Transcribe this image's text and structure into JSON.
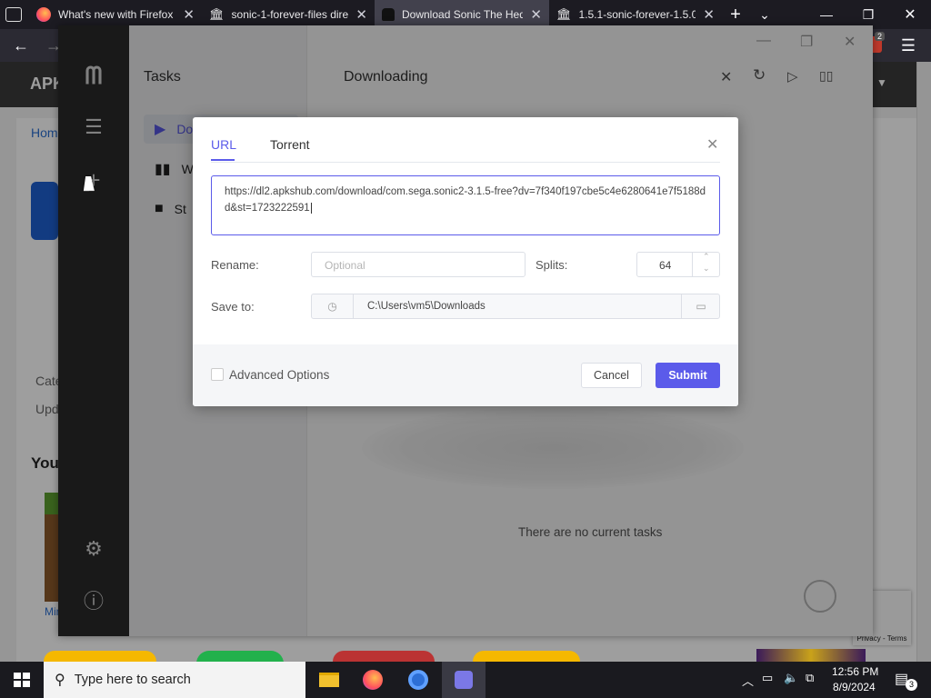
{
  "browser": {
    "tabs": [
      {
        "title": "What's new with Firefox",
        "icon": "firefox-icon",
        "active": false
      },
      {
        "title": "sonic-1-forever-files dire",
        "icon": "archive-icon",
        "active": false
      },
      {
        "title": "Download Sonic The Hed",
        "icon": "android-icon",
        "active": true
      },
      {
        "title": "1.5.1-sonic-forever-1.5.0-",
        "icon": "archive-icon",
        "active": false
      }
    ],
    "badge_count": "2"
  },
  "website": {
    "logo_text": "APK",
    "breadcrumb": "Home",
    "side_label_1": "Cate",
    "side_label_2": "Upd",
    "section": "You",
    "thumb_label": "Min",
    "recaptcha": "Privacy - Terms"
  },
  "app": {
    "sidebar_title": "Tasks",
    "sidebar_items": [
      {
        "label": "Do",
        "icon": "play-icon"
      },
      {
        "label": "W",
        "icon": "pause-icon"
      },
      {
        "label": "St",
        "icon": "stop-icon"
      }
    ],
    "main_title": "Downloading",
    "empty_text": "There are no current tasks"
  },
  "dialog": {
    "tabs": [
      "URL",
      "Torrent"
    ],
    "url_value": "https://dl2.apkshub.com/download/com.sega.sonic2-3.1.5-free?dv=7f340f197cbe5c4e6280641e7f5188dd&st=1723222591",
    "rename_label": "Rename:",
    "rename_placeholder": "Optional",
    "splits_label": "Splits:",
    "splits_value": "64",
    "save_label": "Save to:",
    "save_path": "C:\\Users\\vm5\\Downloads",
    "advanced_label": "Advanced Options",
    "cancel_label": "Cancel",
    "submit_label": "Submit",
    "accent_color": "#5b5bea"
  },
  "taskbar": {
    "search_placeholder": "Type here to search",
    "time": "12:56 PM",
    "date": "8/9/2024",
    "notification_count": "3"
  }
}
